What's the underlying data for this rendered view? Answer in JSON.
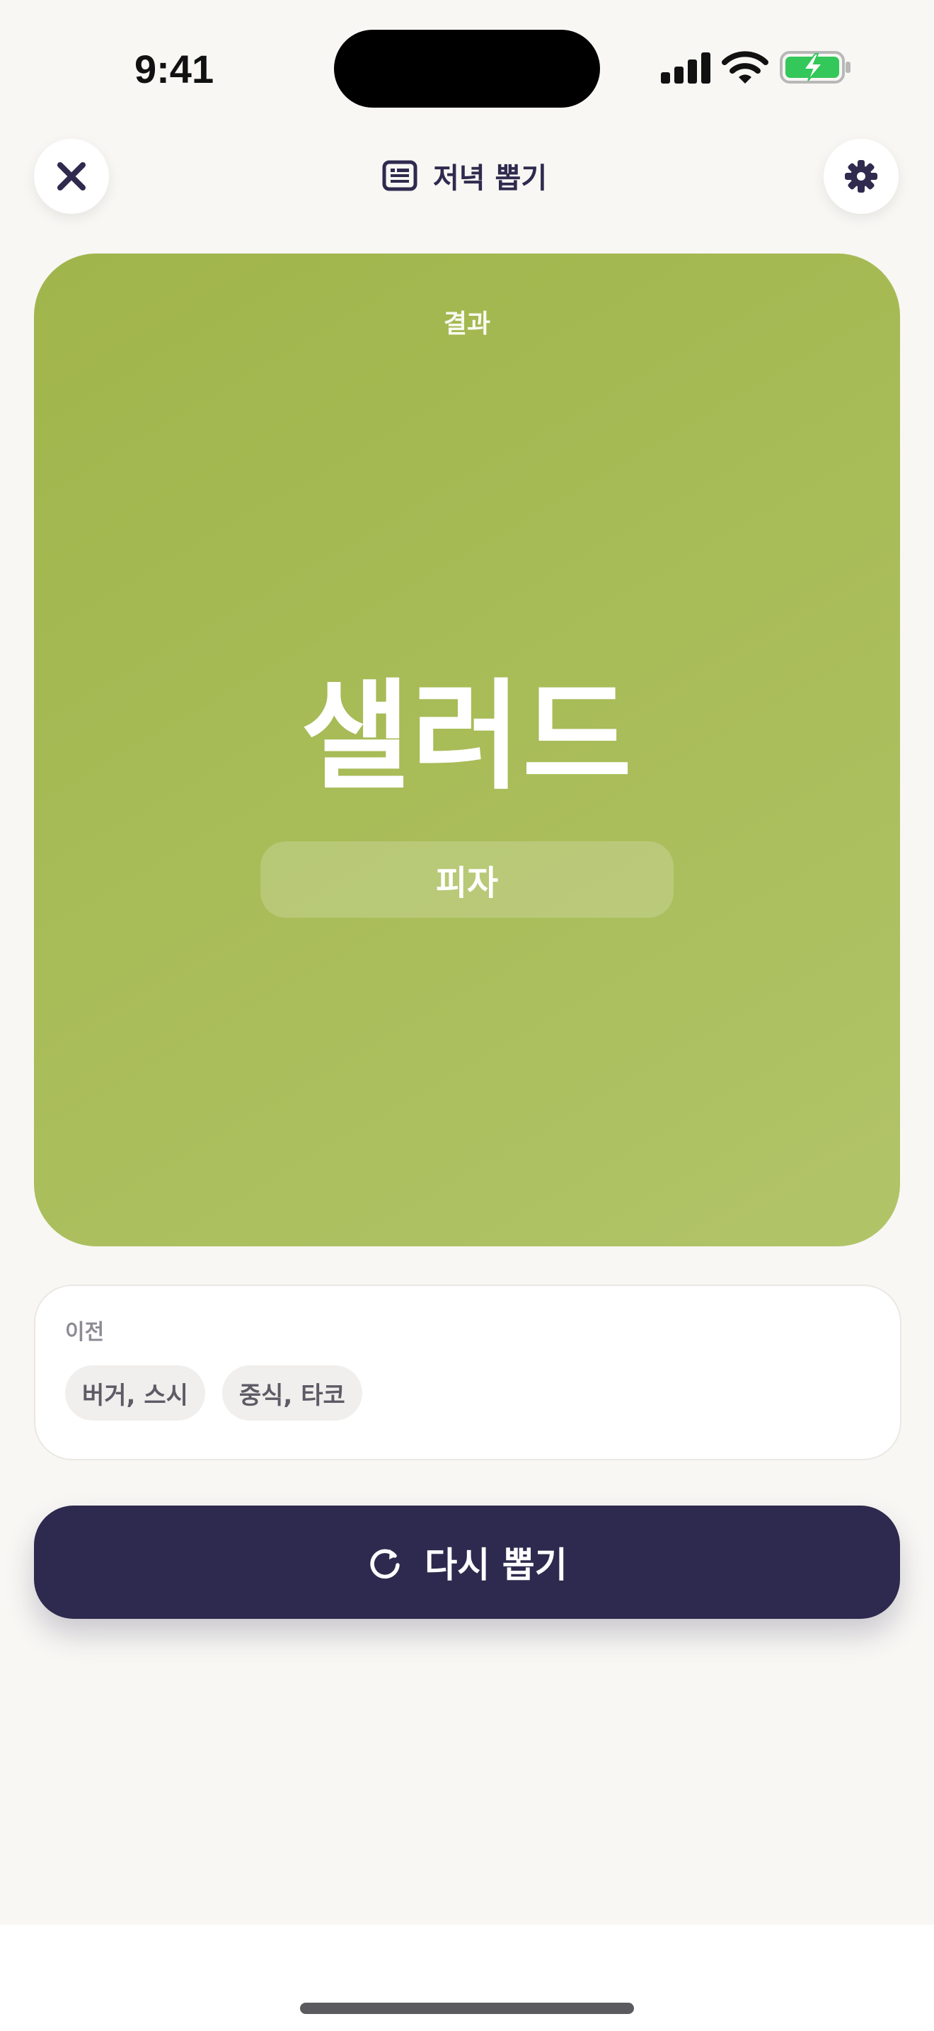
{
  "status_bar": {
    "time": "9:41"
  },
  "header": {
    "title": "저녁 뽑기",
    "title_icon": "list-card-icon",
    "close_icon": "close-icon",
    "settings_icon": "gear-icon"
  },
  "result": {
    "label": "결과",
    "main": "샐러드",
    "sub": "피자"
  },
  "history": {
    "label": "이전",
    "items": [
      "버거, 스시",
      "중식, 타코"
    ]
  },
  "redraw": {
    "label": "다시 뽑기",
    "icon": "refresh-icon"
  },
  "colors": {
    "accent_green": "#a6ba55",
    "primary_navy": "#2e294e",
    "background": "#f8f7f4",
    "battery_green": "#34c759"
  }
}
